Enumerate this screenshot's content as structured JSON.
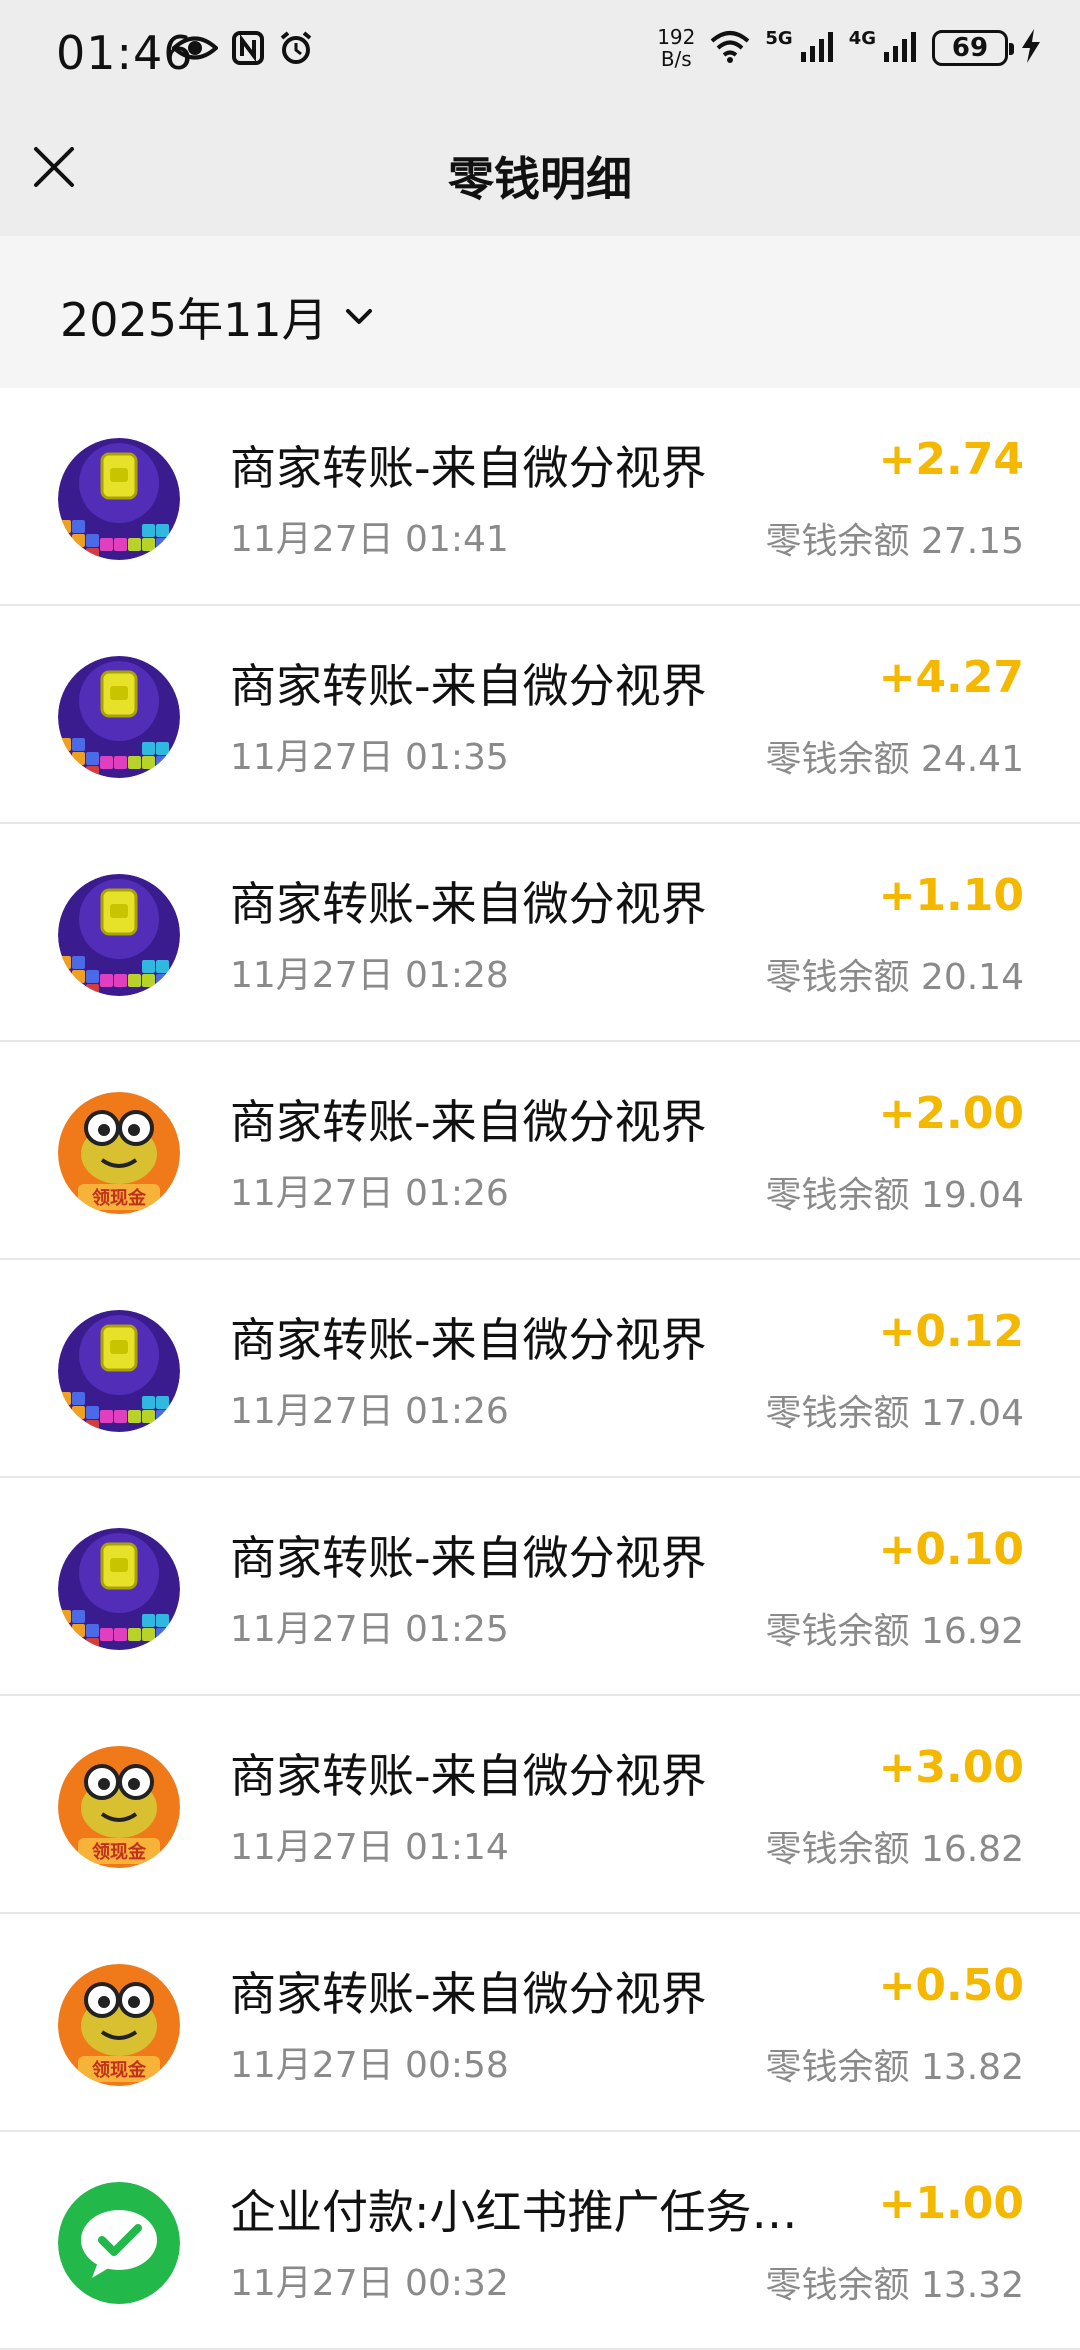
{
  "status_bar": {
    "time": "01:46",
    "speed_top": "192",
    "speed_unit": "B/s",
    "net1": "5G",
    "net2": "4G",
    "battery": "69"
  },
  "header": {
    "title": "零钱明细"
  },
  "filter": {
    "month": "2025年11月"
  },
  "transactions": [
    {
      "title": "商家转账-来自微分视界",
      "time": "11月27日 01:41",
      "amount": "+2.74",
      "balance": "零钱余额 27.15",
      "icon": "block-game-icon"
    },
    {
      "title": "商家转账-来自微分视界",
      "time": "11月27日 01:35",
      "amount": "+4.27",
      "balance": "零钱余额 24.41",
      "icon": "block-game-icon"
    },
    {
      "title": "商家转账-来自微分视界",
      "time": "11月27日 01:28",
      "amount": "+1.10",
      "balance": "零钱余额 20.14",
      "icon": "block-game-icon"
    },
    {
      "title": "商家转账-来自微分视界",
      "time": "11月27日 01:26",
      "amount": "+2.00",
      "balance": "零钱余额 19.04",
      "icon": "frog-icon",
      "badge": "领现金"
    },
    {
      "title": "商家转账-来自微分视界",
      "time": "11月27日 01:26",
      "amount": "+0.12",
      "balance": "零钱余额 17.04",
      "icon": "block-game-icon"
    },
    {
      "title": "商家转账-来自微分视界",
      "time": "11月27日 01:25",
      "amount": "+0.10",
      "balance": "零钱余额 16.92",
      "icon": "block-game-icon"
    },
    {
      "title": "商家转账-来自微分视界",
      "time": "11月27日 01:14",
      "amount": "+3.00",
      "balance": "零钱余额 16.82",
      "icon": "frog-icon",
      "badge": "领现金"
    },
    {
      "title": "商家转账-来自微分视界",
      "time": "11月27日 00:58",
      "amount": "+0.50",
      "balance": "零钱余额 13.82",
      "icon": "frog-icon",
      "badge": "领现金"
    },
    {
      "title": "企业付款:小红书推广任务扫...",
      "time": "11月27日 00:32",
      "amount": "+1.00",
      "balance": "零钱余额 13.32",
      "icon": "wechat-pay-icon"
    }
  ],
  "colors": {
    "amount": "#f5b800",
    "secondary_text": "#8a8a8a",
    "header_bg": "#ededed"
  }
}
